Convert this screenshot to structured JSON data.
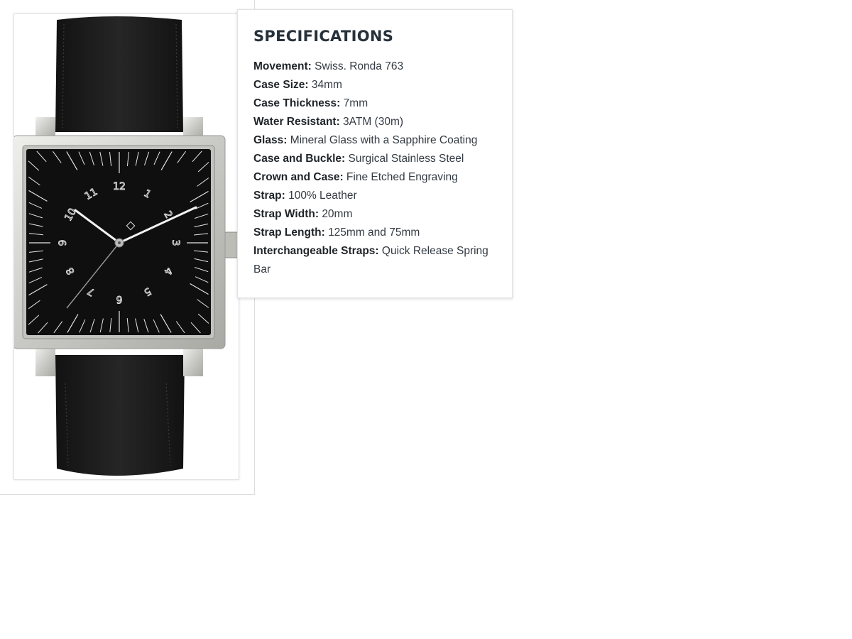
{
  "product_image": {
    "alt": "Square watch with black dial, silver case and black leather strap",
    "dial_numerals": [
      "12",
      "1",
      "2",
      "3",
      "4",
      "5",
      "6",
      "7",
      "8",
      "9",
      "10",
      "11"
    ]
  },
  "colors": {
    "strap": "#1b1b1b",
    "case": "#cfcfcb",
    "dial": "#0f0f0f",
    "text": "#333a42",
    "heading": "#27313a"
  },
  "specifications": {
    "title": "SPECIFICATIONS",
    "rows": [
      {
        "label": "Movement:",
        "value": "Swiss. Ronda 763"
      },
      {
        "label": "Case Size:",
        "value": "34mm"
      },
      {
        "label": "Case Thickness:",
        "value": "7mm"
      },
      {
        "label": "Water Resistant:",
        "value": "3ATM (30m)"
      },
      {
        "label": "Glass:",
        "value": "Mineral Glass with a Sapphire Coating"
      },
      {
        "label": "Case and Buckle:",
        "value": "Surgical Stainless Steel"
      },
      {
        "label": "Crown and Case:",
        "value": "Fine Etched Engraving"
      },
      {
        "label": "Strap:",
        "value": "100% Leather"
      },
      {
        "label": "Strap Width:",
        "value": "20mm"
      },
      {
        "label": "Strap Length:",
        "value": "125mm and 75mm"
      },
      {
        "label": "Interchangeable Straps:",
        "value": "Quick Release Spring Bar"
      }
    ]
  }
}
